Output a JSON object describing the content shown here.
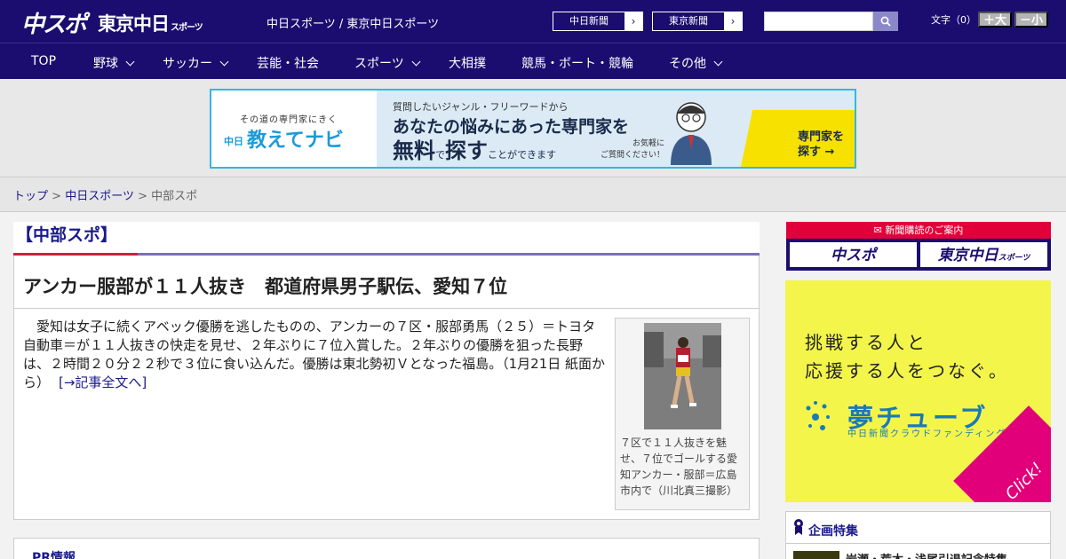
{
  "header": {
    "logo_primary": "中スポ",
    "logo_secondary": "東京中日",
    "logo_secondary_small": "スポーツ",
    "site_names": "中日スポーツ / 東京中日スポーツ",
    "newspaper_links": [
      {
        "label": "中日新聞"
      },
      {
        "label": "東京新聞"
      }
    ],
    "search": {
      "value": "",
      "placeholder": ""
    },
    "font_size_label": "文字（0）",
    "font_larger": "＋大",
    "font_smaller": "－小"
  },
  "nav": {
    "items": [
      {
        "label": "TOP",
        "dropdown": false
      },
      {
        "label": "野球",
        "dropdown": true
      },
      {
        "label": "サッカー",
        "dropdown": true
      },
      {
        "label": "芸能・社会",
        "dropdown": false
      },
      {
        "label": "スポーツ",
        "dropdown": true
      },
      {
        "label": "大相撲",
        "dropdown": false
      },
      {
        "label": "競馬・ボート・競輪",
        "dropdown": false
      },
      {
        "label": "その他",
        "dropdown": true
      }
    ]
  },
  "banner_ad": {
    "tagline": "その道の専門家にきく",
    "brand_small": "中日",
    "brand": "教えてナビ",
    "line1": "質問したいジャンル・フリーワードから",
    "line2": "あなたの悩みにあった専門家を",
    "line3_a": "無料",
    "line3_b": "で",
    "line3_c": "探す",
    "line3_d": "ことができます",
    "note_1": "お気軽に",
    "note_2": "ご質問ください！",
    "cta_1": "専門家を",
    "cta_2": "探す →"
  },
  "breadcrumb": {
    "items": [
      {
        "label": "トップ",
        "link": true
      },
      {
        "label": "中日スポーツ",
        "link": true
      },
      {
        "label": "中部スポ",
        "link": false
      }
    ],
    "separator": ">"
  },
  "section": {
    "title": "【中部スポ】"
  },
  "article": {
    "headline": "アンカー服部が１１人抜き　都道府県男子駅伝、愛知７位",
    "body": "　愛知は女子に続くアベック優勝を逃したものの、アンカーの７区・服部勇馬（２５）＝トヨタ自動車＝が１１人抜きの快走を見せ、２年ぶりに７位入賞した。２年ぶりの優勝を狙った長野は、２時間２０分２２秒で３位に食い込んだ。優勝は東北勢初Ｖとなった福島。（1月21日 紙面から）",
    "read_more": "[→記事全文へ]",
    "photo_caption": "７区で１１人抜きを魅せ、７位でゴールする愛知アンカー・服部＝広島市内で（川北真三撮影）"
  },
  "pr": {
    "title": "PR情報"
  },
  "sidebar": {
    "subscribe_header": "新聞購読のご案内",
    "subscribe_buttons": [
      "中スポ",
      "東京中日"
    ],
    "subscribe_button_small": "スポーツ",
    "yume_ad": {
      "line1": "挑戦する人と",
      "line2": "応援する人をつなぐ。",
      "logo": "夢チューブ",
      "logo_sub": "中日新聞クラウドファンディング",
      "click": "Click!"
    },
    "features": {
      "title": "企画特集",
      "items": [
        {
          "label": "岩瀬・荒木・浅尾引退記念特集"
        }
      ]
    }
  },
  "colors": {
    "header_bg": "#1b0d6f",
    "accent_red": "#d21d3d",
    "link": "#1a1a8c",
    "yume_yellow": "#f3f54b",
    "yume_pink": "#e2007a",
    "banner_border": "#36b6e0"
  }
}
